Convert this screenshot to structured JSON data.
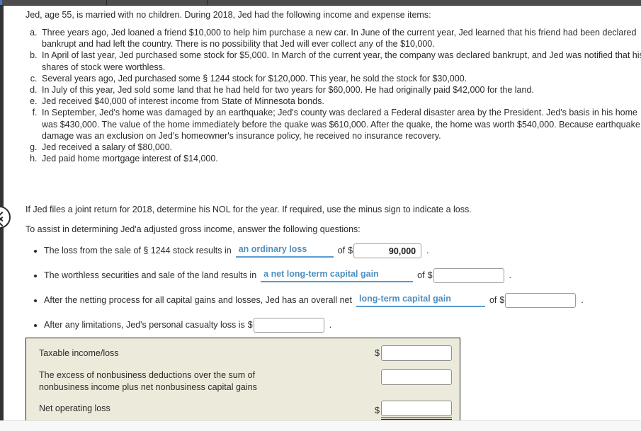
{
  "browser_chrome": {
    "tab_bar_color": "#4d4d4d",
    "accent_color": "#4a77c4"
  },
  "navigation": {
    "prev_button_name": "previous-question",
    "icon": "chevron-left-icon"
  },
  "question": {
    "intro": "Jed, age 55, is married with no children. During 2018, Jed had the following income and expense items:",
    "items": [
      "Three years ago, Jed loaned a friend $10,000 to help him purchase a new car. In June of the current year, Jed learned that his friend had been declared bankrupt and had left the country. There is no possibility that Jed will ever collect any of the $10,000.",
      "In April of last year, Jed purchased some stock for $5,000. In March of the current year, the company was declared bankrupt, and Jed was notified that his shares of stock were worthless.",
      "Several years ago, Jed purchased some § 1244 stock for $120,000. This year, he sold the stock for $30,000.",
      "In July of this year, Jed sold some land that he had held for two years for $60,000. He had originally paid $42,000 for the land.",
      "Jed received $40,000 of interest income from State of Minnesota bonds.",
      "In September, Jed's home was damaged by an earthquake; Jed's county was declared a Federal disaster area by the President. Jed's basis in his home was $430,000. The value of the home immediately before the quake was $610,000. After the quake, the home was worth $540,000. Because earthquake damage was an exclusion on Jed's homeowner's insurance policy, he received no insurance recovery.",
      "Jed received a salary of $80,000.",
      "Jed paid home mortgage interest of $14,000."
    ],
    "joint_return_note": "If Jed files a joint return for 2018, determine his NOL for the year. If required, use the minus sign to indicate a loss.",
    "assist_note": "To assist in determining Jed'a adjusted gross income, answer the following questions:"
  },
  "questions": [
    {
      "prefix": "The loss from the sale of § 1244 stock results in",
      "dropdown_value": "an ordinary loss",
      "mid": "of",
      "dollar": "$",
      "input_value": "90,000",
      "input_placeholder": "",
      "suffix": "."
    },
    {
      "prefix": "The worthless securities and sale of the land results in",
      "dropdown_value": "a net long-term capital gain",
      "mid": "of",
      "dollar": "$",
      "input_value": "",
      "input_placeholder": "",
      "suffix": "."
    },
    {
      "prefix": "After the netting process for all capital gains and losses, Jed has an overall net",
      "dropdown_value": "long-term capital gain",
      "mid": "of",
      "dollar": "$",
      "input_value": "",
      "input_placeholder": "",
      "suffix": "."
    },
    {
      "prefix": "After any limitations, Jed's personal casualty loss is",
      "dropdown_value": "",
      "mid": "",
      "dollar": "$",
      "input_value": "",
      "input_placeholder": "",
      "suffix": "."
    }
  ],
  "answer_table": {
    "background_color": "#eceadb",
    "rows": [
      {
        "label": "Taxable income/loss",
        "dollar": "$",
        "value": "",
        "placeholder": "",
        "is_total": false
      },
      {
        "label_line1": "The excess of nonbusiness deductions over the sum of",
        "label_line2": "nonbusiness income plus net nonbusiness capital gains",
        "dollar": "",
        "value": "",
        "placeholder": "",
        "is_total": false
      },
      {
        "label": "Net operating loss",
        "dollar": "$",
        "value": "",
        "placeholder": "",
        "is_total": true
      }
    ]
  }
}
